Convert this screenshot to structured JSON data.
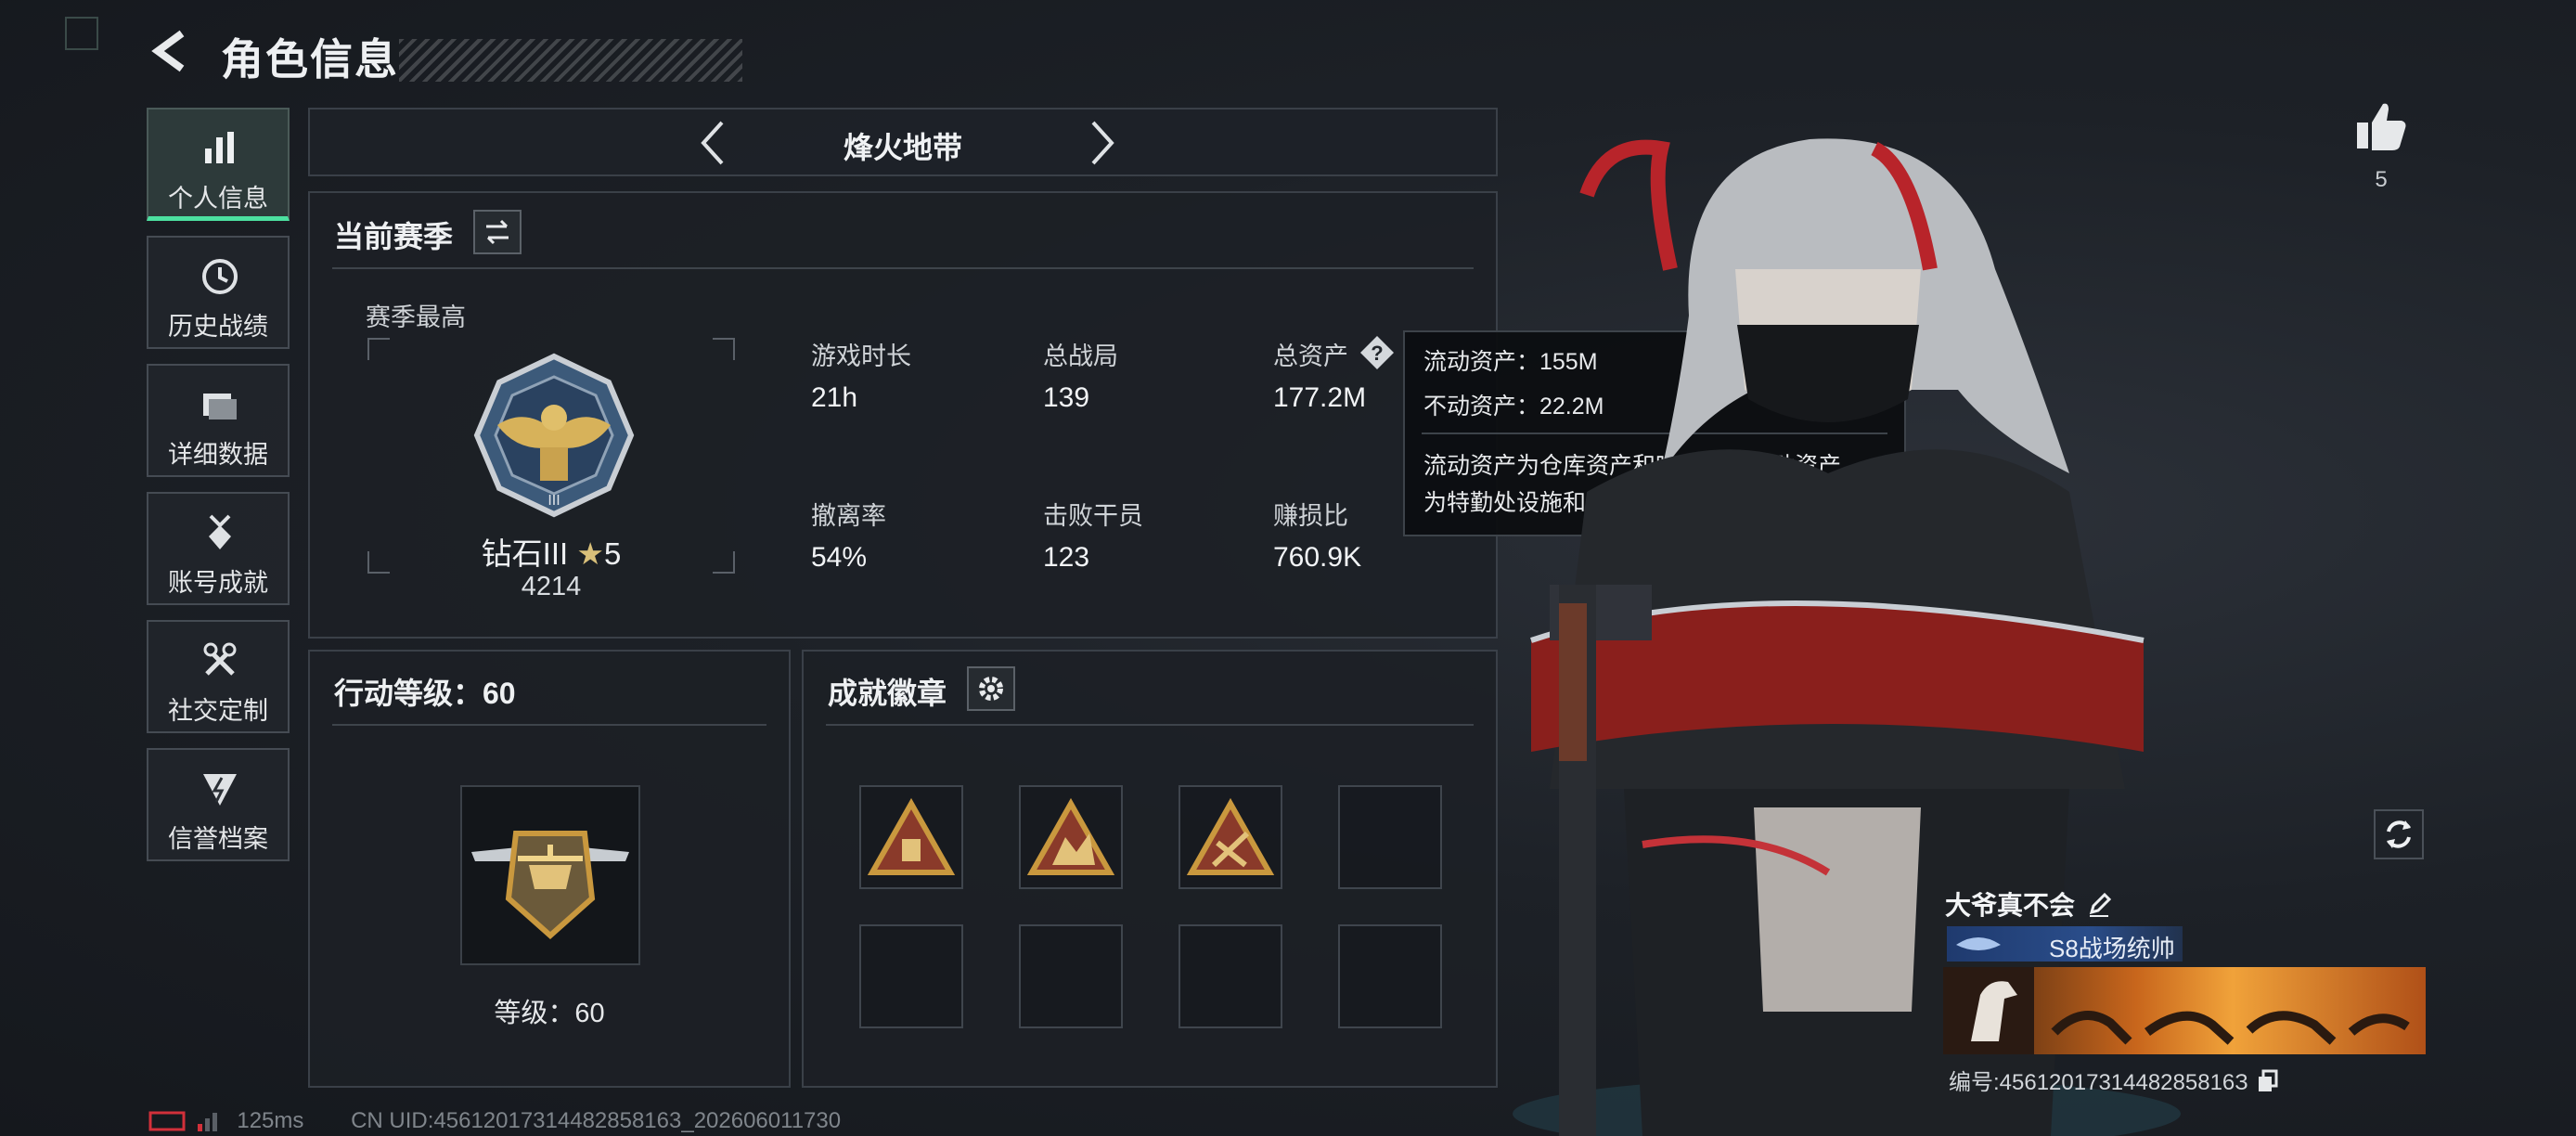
{
  "header": {
    "title": "角色信息"
  },
  "nav": {
    "items": [
      {
        "label": "个人信息",
        "icon": "bar-chart-icon",
        "active": true
      },
      {
        "label": "历史战绩",
        "icon": "clock-icon",
        "active": false
      },
      {
        "label": "详细数据",
        "icon": "folder-icon",
        "active": false
      },
      {
        "label": "账号成就",
        "icon": "medal-icon",
        "active": false
      },
      {
        "label": "社交定制",
        "icon": "tools-icon",
        "active": false
      },
      {
        "label": "信誉档案",
        "icon": "shield-icon",
        "active": false
      }
    ]
  },
  "mode_tab": {
    "title": "烽火地带"
  },
  "season": {
    "title": "当前赛季",
    "peak_label": "赛季最高",
    "rank_name": "钻石III",
    "rank_stars": "5",
    "rank_score": "4214",
    "stats": [
      {
        "label": "游戏时长",
        "value": "21h"
      },
      {
        "label": "总战局",
        "value": "139"
      },
      {
        "label": "总资产",
        "value": "177.2M"
      },
      {
        "label": "撤离率",
        "value": "54%"
      },
      {
        "label": "击败干员",
        "value": "123"
      },
      {
        "label": "赚损比",
        "value": "760.9K"
      }
    ]
  },
  "tooltip": {
    "liquid": "流动资产：155M",
    "fixed": "不动资产：22.2M",
    "desc_line1": "流动资产为仓库资产和哈夫币，不动资产",
    "desc_line2": "为特勤处设施和收藏室设施"
  },
  "action_level": {
    "title": "行动等级：60",
    "level_label": "等级：60"
  },
  "achievements": {
    "title": "成就徽章",
    "slots": [
      "badge-a",
      "badge-b",
      "badge-c",
      "",
      "",
      "",
      "",
      ""
    ]
  },
  "profile": {
    "likes": "5",
    "player_name": "大爷真不会",
    "title_tag": "S8战场统帅",
    "id_line": "编号:4561201731448285816З"
  },
  "footer": {
    "ping": "125ms",
    "uid_line": "CN UID:456120173144828​58163_202606011730"
  },
  "colors": {
    "accent": "#4ce0a0",
    "badge_gold": "#c9983e",
    "tag_blue": "#2a4d8a"
  }
}
